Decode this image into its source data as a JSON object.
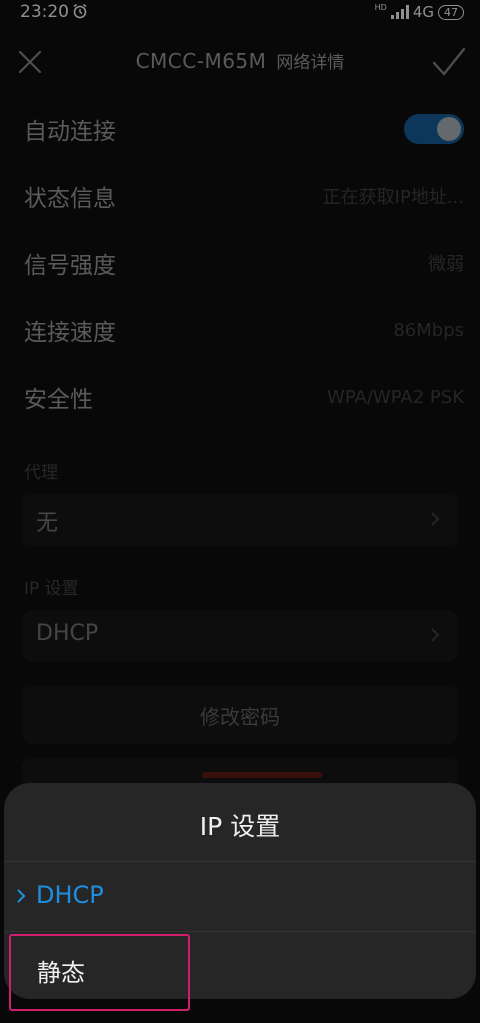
{
  "status_bar": {
    "time": "23:20",
    "hd": "HD",
    "network": "4G",
    "battery": "47"
  },
  "header": {
    "ssid": "CMCC-M65M",
    "subtitle": "网络详情"
  },
  "details": {
    "auto_connect": {
      "label": "自动连接",
      "enabled": true
    },
    "status": {
      "label": "状态信息",
      "value": "正在获取IP地址..."
    },
    "signal": {
      "label": "信号强度",
      "value": "微弱"
    },
    "speed": {
      "label": "连接速度",
      "value": "86Mbps"
    },
    "security": {
      "label": "安全性",
      "value": "WPA/WPA2 PSK"
    }
  },
  "proxy": {
    "label": "代理",
    "value": "无"
  },
  "ip_settings": {
    "label": "IP 设置",
    "value": "DHCP"
  },
  "actions": {
    "change_password": "修改密码"
  },
  "sheet": {
    "title": "IP  设置",
    "options": [
      {
        "label": "DHCP",
        "selected": true
      },
      {
        "label": "静态",
        "selected": false
      }
    ]
  },
  "colors": {
    "accent": "#1e8fde",
    "toggle_on": "#13558a",
    "highlight": "#d01e6e"
  },
  "icons": [
    "alarm-icon",
    "signal-icon",
    "battery-icon",
    "close-icon",
    "check-icon",
    "chevron-right-icon"
  ]
}
